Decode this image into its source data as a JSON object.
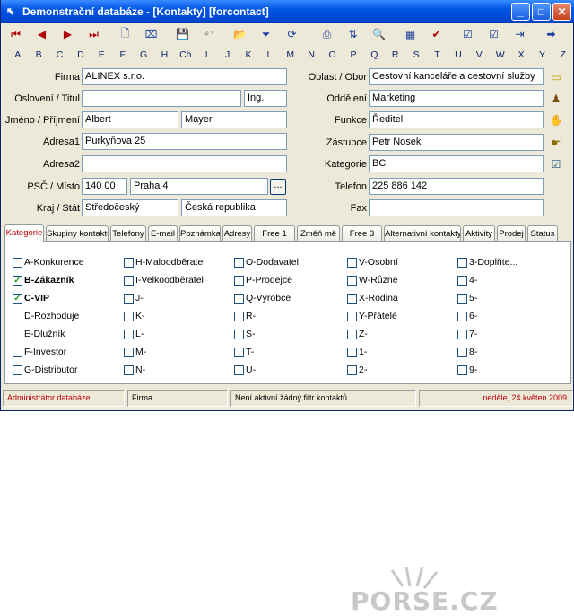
{
  "window": {
    "title": "Demonstrační databáze - [Kontakty] [forcontact]",
    "min": "_",
    "max": "□",
    "close": "✕"
  },
  "toolbar": [
    {
      "icon": "first-record-icon",
      "glyph": "⏮",
      "cls": "red"
    },
    {
      "icon": "previous-record-icon",
      "glyph": "◀",
      "cls": "red"
    },
    {
      "icon": "next-record-icon",
      "glyph": "▶",
      "cls": "red"
    },
    {
      "icon": "last-record-icon",
      "glyph": "⏭",
      "cls": "red"
    },
    {
      "icon": "new-record-icon",
      "glyph": "🗋",
      "cls": ""
    },
    {
      "icon": "delete-record-icon",
      "glyph": "⌧",
      "cls": ""
    },
    {
      "icon": "save-icon",
      "glyph": "💾",
      "cls": "gray"
    },
    {
      "icon": "undo-icon",
      "glyph": "↶",
      "cls": "gray"
    },
    {
      "icon": "open-folder-icon",
      "glyph": "📂",
      "cls": ""
    },
    {
      "icon": "filter-icon",
      "glyph": "⏷",
      "cls": ""
    },
    {
      "icon": "refresh-icon",
      "glyph": "⟳",
      "cls": ""
    },
    {
      "icon": "print-icon",
      "glyph": "⎙",
      "cls": ""
    },
    {
      "icon": "sort-az-icon",
      "glyph": "⇅",
      "cls": ""
    },
    {
      "icon": "find-icon",
      "glyph": "🔍",
      "cls": ""
    },
    {
      "icon": "table-view-icon",
      "glyph": "▦",
      "cls": ""
    },
    {
      "icon": "check-red-icon",
      "glyph": "✔",
      "cls": "red"
    },
    {
      "icon": "check-box-icon",
      "glyph": "☑",
      "cls": ""
    },
    {
      "icon": "check-blue-icon",
      "glyph": "☑",
      "cls": ""
    },
    {
      "icon": "exit-door-icon",
      "glyph": "⇥",
      "cls": ""
    },
    {
      "icon": "forward-arrow-icon",
      "glyph": "➡",
      "cls": ""
    }
  ],
  "alphabet": [
    "A",
    "B",
    "C",
    "D",
    "E",
    "F",
    "G",
    "H",
    "Ch",
    "I",
    "J",
    "K",
    "L",
    "M",
    "N",
    "O",
    "P",
    "Q",
    "R",
    "S",
    "T",
    "U",
    "V",
    "W",
    "X",
    "Y",
    "Z"
  ],
  "form": {
    "firma_label": "Firma",
    "firma": "ALINEX s.r.o.",
    "osloveni_label": "Oslovení / Titul",
    "osloveni": "",
    "titul": "Ing.",
    "jmeno_label": "Jméno / Příjmení",
    "jmeno": "Albert",
    "prijmeni": "Mayer",
    "adresa1_label": "Adresa1",
    "adresa1": "Purkyňova 25",
    "adresa2_label": "Adresa2",
    "adresa2": "",
    "psc_label": "PSČ / Místo",
    "psc": "140 00",
    "misto": "Praha 4",
    "browse": "...",
    "kraj_label": "Kraj / Stát",
    "kraj": "Středočeský",
    "stat": "Česká republika",
    "oblast_label": "Oblast / Obor",
    "oblast": "Cestovní kanceláře a cestovní služby",
    "oddeleni_label": "Oddělení",
    "oddeleni": "Marketing",
    "funkce_label": "Funkce",
    "funkce": "Ředitel",
    "zastupce_label": "Zástupce",
    "zastupce": "Petr Nosek",
    "kategorie_label": "Kategorie",
    "kategorie": "BC",
    "telefon_label": "Telefon",
    "telefon": "225 886 142",
    "fax_label": "Fax",
    "fax": ""
  },
  "tabs": [
    "Kategorie",
    "Skupiny kontaktů",
    "Telefony",
    "E-mail",
    "Poznámka",
    "Adresy",
    "Free 1",
    "Změň mě",
    "Free 3",
    "Alternativní kontakty",
    "Aktivity",
    "Prodej",
    "Status"
  ],
  "categories": [
    [
      {
        "l": "A-Konkurence",
        "c": false,
        "b": false
      },
      {
        "l": "B-Zákazník",
        "c": true,
        "b": true
      },
      {
        "l": "C-VIP",
        "c": true,
        "b": true
      },
      {
        "l": "D-Rozhoduje",
        "c": false,
        "b": false
      },
      {
        "l": "E-Dlužník",
        "c": false,
        "b": false
      },
      {
        "l": "F-Investor",
        "c": false,
        "b": false
      },
      {
        "l": "G-Distributor",
        "c": false,
        "b": false
      }
    ],
    [
      {
        "l": "H-Maloodběratel",
        "c": false,
        "b": false
      },
      {
        "l": "I-Velkoodběratel",
        "c": false,
        "b": false
      },
      {
        "l": "J-",
        "c": false,
        "b": false
      },
      {
        "l": "K-",
        "c": false,
        "b": false
      },
      {
        "l": "L-",
        "c": false,
        "b": false
      },
      {
        "l": "M-",
        "c": false,
        "b": false
      },
      {
        "l": "N-",
        "c": false,
        "b": false
      }
    ],
    [
      {
        "l": "O-Dodavatel",
        "c": false,
        "b": false
      },
      {
        "l": "P-Prodejce",
        "c": false,
        "b": false
      },
      {
        "l": "Q-Výrobce",
        "c": false,
        "b": false
      },
      {
        "l": "R-",
        "c": false,
        "b": false
      },
      {
        "l": "S-",
        "c": false,
        "b": false
      },
      {
        "l": "T-",
        "c": false,
        "b": false
      },
      {
        "l": "U-",
        "c": false,
        "b": false
      }
    ],
    [
      {
        "l": "V-Osobní",
        "c": false,
        "b": false
      },
      {
        "l": "W-Různé",
        "c": false,
        "b": false
      },
      {
        "l": "X-Rodina",
        "c": false,
        "b": false
      },
      {
        "l": "Y-Přátelé",
        "c": false,
        "b": false
      },
      {
        "l": "Z-",
        "c": false,
        "b": false
      },
      {
        "l": "1-",
        "c": false,
        "b": false
      },
      {
        "l": "2-",
        "c": false,
        "b": false
      }
    ],
    [
      {
        "l": "3-Doplňte...",
        "c": false,
        "b": false
      },
      {
        "l": "4-",
        "c": false,
        "b": false
      },
      {
        "l": "5-",
        "c": false,
        "b": false
      },
      {
        "l": "6-",
        "c": false,
        "b": false
      },
      {
        "l": "7-",
        "c": false,
        "b": false
      },
      {
        "l": "8-",
        "c": false,
        "b": false
      },
      {
        "l": "9-",
        "c": false,
        "b": false
      }
    ]
  ],
  "watermark": "PORSE.CZ",
  "status": {
    "user": "Administrátor databáze",
    "table": "Firma",
    "filter": "Není aktivní žádný filtr kontaktů",
    "date": "neděle, 24 květen 2009"
  }
}
